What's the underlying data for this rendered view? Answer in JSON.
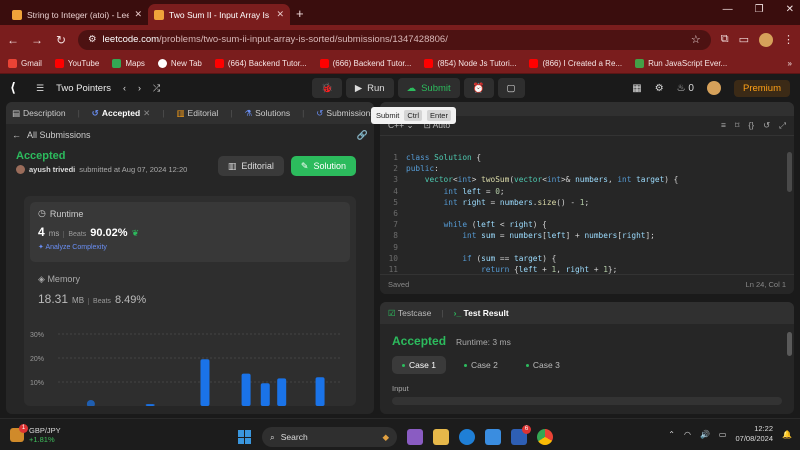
{
  "browser": {
    "tabs": [
      {
        "title": "String to Integer (atoi) - LeetCo",
        "active": false
      },
      {
        "title": "Two Sum II - Input Array Is Sort",
        "active": true
      }
    ],
    "url_domain": "leetcode.com",
    "url_path": "/problems/two-sum-ii-input-array-is-sorted/submissions/1347428806/",
    "bookmarks": [
      {
        "label": "Gmail",
        "color": "#ea4335"
      },
      {
        "label": "YouTube",
        "color": "#ff0000"
      },
      {
        "label": "Maps",
        "color": "#34a853"
      },
      {
        "label": "New Tab",
        "color": "#ffffff"
      },
      {
        "label": "(664) Backend Tutor...",
        "color": "#ff0000"
      },
      {
        "label": "(666) Backend Tutor...",
        "color": "#ff0000"
      },
      {
        "label": "(854) Node Js Tutori...",
        "color": "#ff0000"
      },
      {
        "label": "(866) I Created a Re...",
        "color": "#ff0000"
      },
      {
        "label": "Run JavaScript Ever...",
        "color": "#43a047"
      }
    ],
    "bookmarks_more": "»"
  },
  "lcnav": {
    "problem_list": "Two Pointers",
    "run": "Run",
    "submit": "Submit",
    "fire_count": "0",
    "premium": "Premium"
  },
  "tooltip": {
    "label": "Submit",
    "key1": "Ctrl",
    "key2": "Enter"
  },
  "left_tabs": [
    "Description",
    "Accepted",
    "Editorial",
    "Solutions",
    "Submissions"
  ],
  "submission": {
    "back": "All Submissions",
    "status": "Accepted",
    "user": "ayush trivedi",
    "submitted": "submitted at Aug 07, 2024 12:20",
    "editorial_btn": "Editorial",
    "solution_btn": "Solution",
    "runtime_label": "Runtime",
    "runtime_value": "4",
    "runtime_unit": "ms",
    "beats_label": "Beats",
    "runtime_beats": "90.02%",
    "analyze": "Analyze Complexity",
    "memory_label": "Memory",
    "memory_value": "18.31",
    "memory_unit": "MB",
    "memory_beats": "8.49%"
  },
  "chart_data": {
    "type": "bar",
    "yticks": [
      "30%",
      "20%",
      "10%"
    ],
    "ylim": [
      0,
      30
    ],
    "bars": [
      {
        "x": 0.12,
        "value": 0
      },
      {
        "x": 0.32,
        "value": 0.8
      },
      {
        "x": 0.52,
        "value": 19.5
      },
      {
        "x": 0.67,
        "value": 13.5
      },
      {
        "x": 0.74,
        "value": 9.5
      },
      {
        "x": 0.8,
        "value": 11.5
      },
      {
        "x": 0.94,
        "value": 12
      }
    ]
  },
  "editor": {
    "language": "C++",
    "mode": "Auto",
    "status": "Saved",
    "cursor": "Ln 24, Col 1",
    "code_lines": [
      [
        [
          "kw",
          "class "
        ],
        [
          "ty",
          "Solution "
        ],
        [
          "ct",
          "{"
        ]
      ],
      [
        [
          "kw",
          "public"
        ],
        [
          "ct",
          ":"
        ]
      ],
      [
        [
          "ct",
          "    "
        ],
        [
          "ty",
          "vector"
        ],
        [
          "ct",
          "<"
        ],
        [
          "kw",
          "int"
        ],
        [
          "ct",
          "> "
        ],
        [
          "fn",
          "twoSum"
        ],
        [
          "ct",
          "("
        ],
        [
          "ty",
          "vector"
        ],
        [
          "ct",
          "<"
        ],
        [
          "kw",
          "int"
        ],
        [
          "ct",
          ">& "
        ],
        [
          "vr",
          "numbers"
        ],
        [
          "ct",
          ", "
        ],
        [
          "kw",
          "int "
        ],
        [
          "vr",
          "target"
        ],
        [
          "ct",
          ") {"
        ]
      ],
      [
        [
          "ct",
          "        "
        ],
        [
          "kw",
          "int "
        ],
        [
          "vr",
          "left"
        ],
        [
          "ct",
          " = "
        ],
        [
          "nm",
          "0"
        ],
        [
          "ct",
          ";"
        ]
      ],
      [
        [
          "ct",
          "        "
        ],
        [
          "kw",
          "int "
        ],
        [
          "vr",
          "right"
        ],
        [
          "ct",
          " = "
        ],
        [
          "vr",
          "numbers"
        ],
        [
          "ct",
          "."
        ],
        [
          "fn",
          "size"
        ],
        [
          "ct",
          "() - "
        ],
        [
          "nm",
          "1"
        ],
        [
          "ct",
          ";"
        ]
      ],
      [
        [
          "ct",
          ""
        ]
      ],
      [
        [
          "ct",
          "        "
        ],
        [
          "kw",
          "while "
        ],
        [
          "ct",
          "("
        ],
        [
          "vr",
          "left"
        ],
        [
          "ct",
          " < "
        ],
        [
          "vr",
          "right"
        ],
        [
          "ct",
          ") {"
        ]
      ],
      [
        [
          "ct",
          "            "
        ],
        [
          "kw",
          "int "
        ],
        [
          "vr",
          "sum"
        ],
        [
          "ct",
          " = "
        ],
        [
          "vr",
          "numbers"
        ],
        [
          "ct",
          "["
        ],
        [
          "vr",
          "left"
        ],
        [
          "ct",
          "] + "
        ],
        [
          "vr",
          "numbers"
        ],
        [
          "ct",
          "["
        ],
        [
          "vr",
          "right"
        ],
        [
          "ct",
          "];"
        ]
      ],
      [
        [
          "ct",
          ""
        ]
      ],
      [
        [
          "ct",
          "            "
        ],
        [
          "kw",
          "if "
        ],
        [
          "ct",
          "("
        ],
        [
          "vr",
          "sum"
        ],
        [
          "ct",
          " == "
        ],
        [
          "vr",
          "target"
        ],
        [
          "ct",
          ") {"
        ]
      ],
      [
        [
          "ct",
          "                "
        ],
        [
          "kw",
          "return "
        ],
        [
          "ct",
          "{"
        ],
        [
          "vr",
          "left"
        ],
        [
          "ct",
          " + "
        ],
        [
          "nm",
          "1"
        ],
        [
          "ct",
          ", "
        ],
        [
          "vr",
          "right"
        ],
        [
          "ct",
          " + "
        ],
        [
          "nm",
          "1"
        ],
        [
          "ct",
          "};"
        ]
      ]
    ]
  },
  "testpanel": {
    "tab1": "Testcase",
    "tab2": "Test Result",
    "result": "Accepted",
    "runtime": "Runtime: 3 ms",
    "cases": [
      "Case 1",
      "Case 2",
      "Case 3"
    ],
    "input_label": "Input"
  },
  "taskbar": {
    "ticker": "GBP/JPY",
    "change": "+1.81%",
    "notif": "1",
    "search": "Search",
    "time": "12:22",
    "date": "07/08/2024",
    "app_badge": "6"
  }
}
